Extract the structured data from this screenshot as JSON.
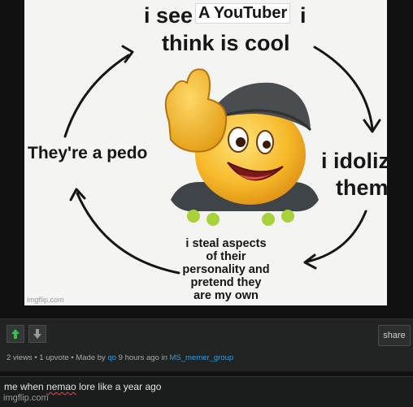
{
  "meme": {
    "top_line_1": "i see",
    "top_box": "A YouTuber",
    "top_line_1_end": "i",
    "top_line_2": "think is cool",
    "left_text": "They're a pedo",
    "right_line_1": "i idolize",
    "right_line_2": "them",
    "bottom_lines": [
      "i steal aspects",
      "of their",
      "personality and",
      "pretend they",
      "are my own"
    ],
    "watermark": "imgflip.com"
  },
  "post": {
    "share_label": "share",
    "views": "2 views",
    "upvotes": "1 upvote",
    "made_by_prefix": "Made by",
    "author": "qo",
    "time": "9 hours ago in",
    "stream": "MS_memer_group",
    "separator": "•"
  },
  "comment": {
    "before": "me when ",
    "misspelled": "nemao",
    "after": " lore like a year ago",
    "watermark": "imgflip.com"
  },
  "colors": {
    "upvote_arrow": "#34c24a",
    "downvote_arrow": "#9a9a9a",
    "link": "#2e9fe6",
    "spellcheck": "#d23a3a"
  }
}
